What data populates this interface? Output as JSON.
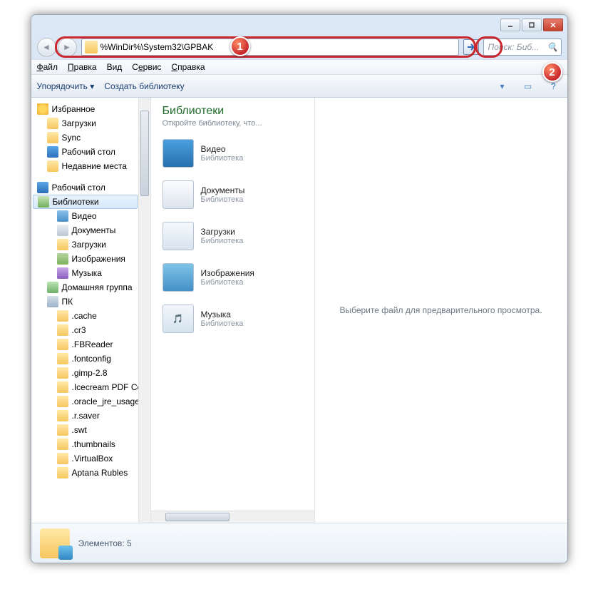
{
  "window": {
    "title": ""
  },
  "addressbar": {
    "value": "%WinDir%\\System32\\GPBAK"
  },
  "search": {
    "placeholder": "Поиск: Биб..."
  },
  "menubar": {
    "file": "Файл",
    "edit": "Правка",
    "view": "Вид",
    "tools": "Сервис",
    "help": "Справка"
  },
  "cmdbar": {
    "organize": "Упорядочить",
    "newlib": "Создать библиотеку"
  },
  "nav": {
    "favorites": "Избранное",
    "downloads": "Загрузки",
    "sync": "Sync",
    "desktop": "Рабочий стол",
    "recent": "Недавние места",
    "desktop2": "Рабочий стол",
    "libraries": "Библиотеки",
    "video": "Видео",
    "docs": "Документы",
    "dl": "Загрузки",
    "images": "Изображения",
    "music": "Музыка",
    "homegroup": "Домашняя группа",
    "pc": "ПК",
    "f": [
      ".cache",
      ".cr3",
      ".FBReader",
      ".fontconfig",
      ".gimp-2.8",
      ".Icecream PDF Conv",
      ".oracle_jre_usage",
      ".r.saver",
      ".swt",
      ".thumbnails",
      ".VirtualBox",
      "Aptana Rubles"
    ]
  },
  "main": {
    "title": "Библиотеки",
    "subtitle": "Откройте библиотеку, что...",
    "items": [
      {
        "name": "Видео",
        "cat": "Библиотека"
      },
      {
        "name": "Документы",
        "cat": "Библиотека"
      },
      {
        "name": "Загрузки",
        "cat": "Библиотека"
      },
      {
        "name": "Изображения",
        "cat": "Библиотека"
      },
      {
        "name": "Музыка",
        "cat": "Библиотека"
      }
    ]
  },
  "preview": {
    "empty": "Выберите файл для предварительного просмотра."
  },
  "status": {
    "label": "Элементов: 5"
  },
  "callouts": {
    "one": "1",
    "two": "2"
  }
}
